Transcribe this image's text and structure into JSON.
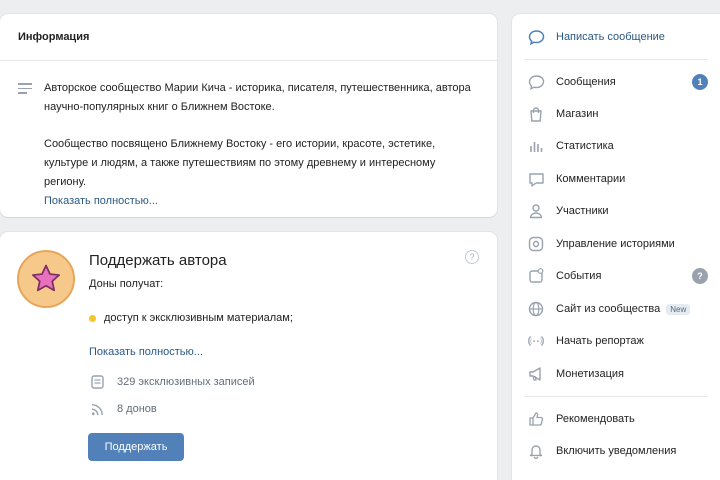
{
  "info": {
    "header": "Информация",
    "para1": "Авторское сообщество Марии Кича - историка, писателя, путешественника, автора научно-популярных книг о Ближнем Востоке.",
    "para2": "Сообщество посвящено Ближнему Востоку - его истории, красоте, эстетике, культуре и людям, а также путешествиям по этому древнему и интересному региону.",
    "show_more": "Показать полностью..."
  },
  "support": {
    "title": "Поддержать автора",
    "donors_get": "Доны получат:",
    "benefit": "доступ к эксклюзивным материалам;",
    "show_more": "Показать полностью...",
    "posts": "329 эксклюзивных записей",
    "donors": "8 донов",
    "button": "Поддержать",
    "help": "?"
  },
  "sidebar": {
    "write_message": "Написать сообщение",
    "items": [
      {
        "label": "Сообщения",
        "icon": "message-icon",
        "badge": "1"
      },
      {
        "label": "Магазин",
        "icon": "shopping-bag-icon"
      },
      {
        "label": "Статистика",
        "icon": "stats-icon"
      },
      {
        "label": "Комментарии",
        "icon": "comment-icon"
      },
      {
        "label": "Участники",
        "icon": "user-icon"
      },
      {
        "label": "Управление историями",
        "icon": "stories-icon"
      },
      {
        "label": "События",
        "icon": "event-icon",
        "badge": "?"
      },
      {
        "label": "Сайт из сообщества",
        "icon": "globe-icon",
        "tag": "New"
      },
      {
        "label": "Начать репортаж",
        "icon": "live-icon"
      },
      {
        "label": "Монетизация",
        "icon": "megaphone-icon"
      }
    ],
    "recommend": "Рекомендовать",
    "notifications": "Включить уведомления"
  },
  "colors": {
    "accent": "#5181b8",
    "link": "#2a5885",
    "background": "#edeef0",
    "star": "#e96fbf",
    "bullet": "#f4c431"
  }
}
